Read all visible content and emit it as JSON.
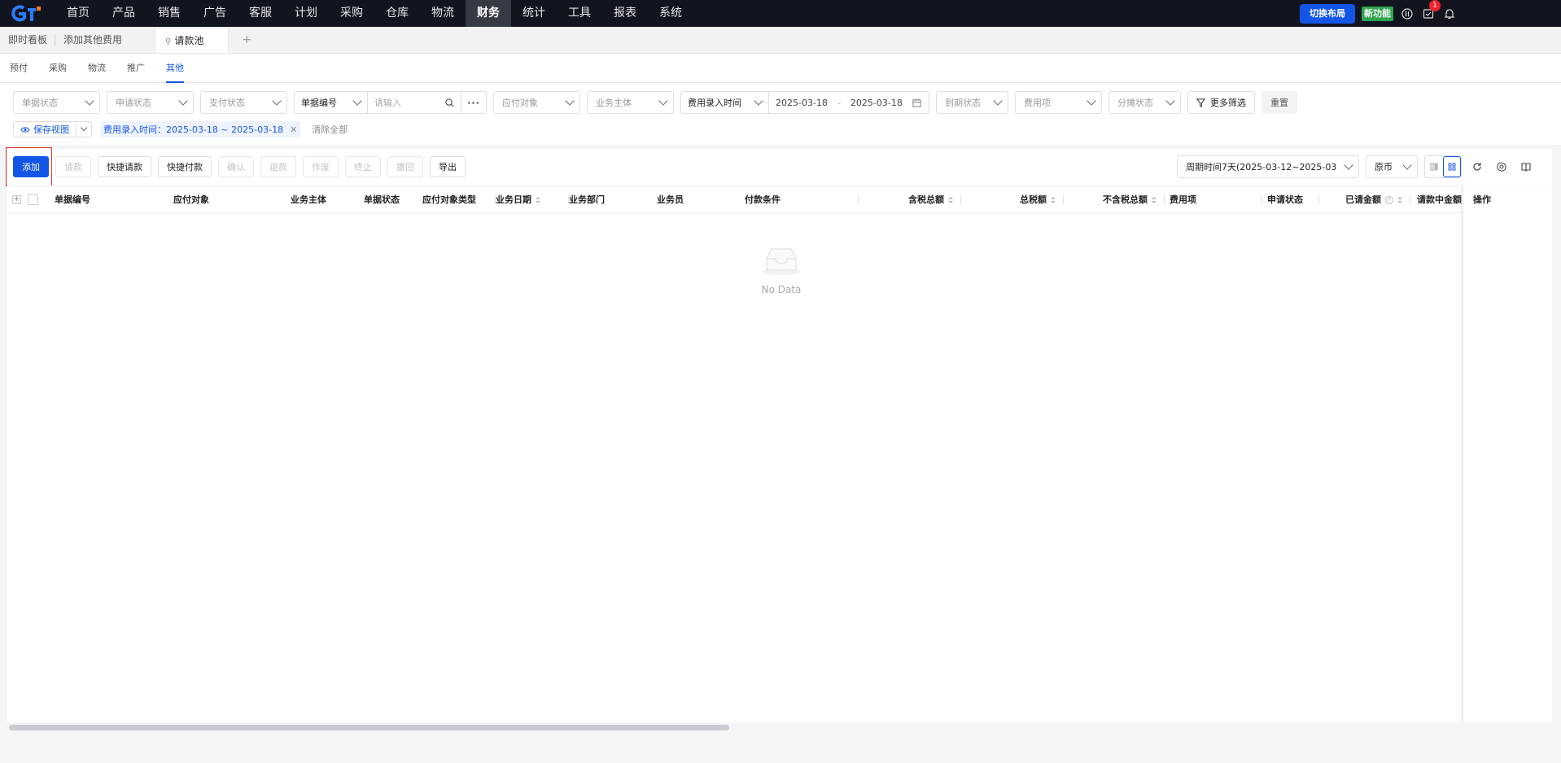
{
  "nav": {
    "items": [
      "首页",
      "产品",
      "销售",
      "广告",
      "客服",
      "计划",
      "采购",
      "仓库",
      "物流",
      "财务",
      "统计",
      "工具",
      "报表",
      "系统"
    ],
    "active_index": 9,
    "switch_layout": "切换布局",
    "new_feature": "新功能",
    "notification_count": "1"
  },
  "page_tabs": {
    "items": [
      "即时看板",
      "添加其他费用"
    ],
    "active": "请款池",
    "add": "+"
  },
  "sub_tabs": {
    "items": [
      "预付",
      "采购",
      "物流",
      "推广",
      "其他"
    ],
    "active_index": 4
  },
  "filters": {
    "doc_status": "单据状态",
    "apply_status": "申请状态",
    "pay_status": "支付状态",
    "field_select": "单据编号",
    "search_placeholder": "请输入",
    "payee": "应付对象",
    "business_entity": "业务主体",
    "time_select": "费用录入时间",
    "date_start": "2025-03-18",
    "date_sep": "-",
    "date_end": "2025-03-18",
    "due_status": "到期状态",
    "expense_item": "费用项",
    "split_status": "分摊状态",
    "more_filters": "更多筛选",
    "reset": "重置"
  },
  "active_filters": {
    "save_view": "保存视图",
    "tag": "费用录入时间：2025-03-18 ~ 2025-03-18",
    "clear_all": "清除全部"
  },
  "toolbar": {
    "add": "添加",
    "request": "请款",
    "quick_request": "快捷请款",
    "quick_pay": "快捷付款",
    "confirm": "确认",
    "refund": "退款",
    "void": "作废",
    "terminate": "终止",
    "revoke": "撤回",
    "export": "导出",
    "period": "周期时间7天(2025-03-12~2025-03",
    "currency": "原币"
  },
  "table": {
    "columns": [
      "单据编号",
      "应付对象",
      "业务主体",
      "单据状态",
      "应付对象类型",
      "业务日期",
      "业务部门",
      "业务员",
      "付款条件",
      "含税总额",
      "总税额",
      "不含税总额",
      "费用项",
      "申请状态",
      "已请金额",
      "请款中金额",
      "操作"
    ],
    "empty_text": "No Data"
  },
  "colors": {
    "primary": "#1356e6",
    "nav_bg": "#12151f",
    "new_feature": "#2ea44f",
    "highlight": "#e0352b"
  }
}
